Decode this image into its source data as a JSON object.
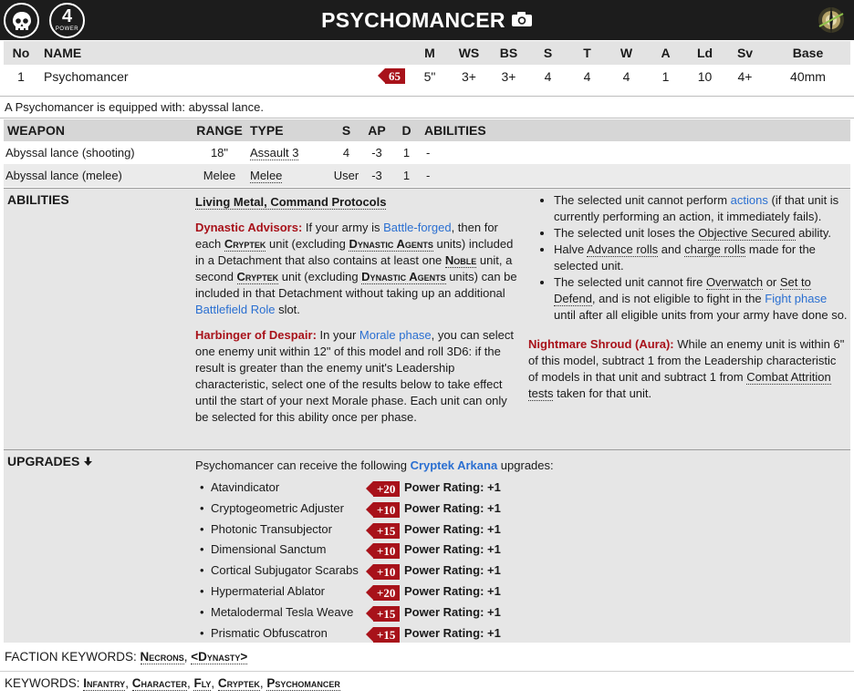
{
  "header": {
    "title": "PSYCHOMANCER",
    "power_value": "4",
    "power_label": "POWER",
    "skull_icon": "skull-icon",
    "camera_icon": "camera-icon",
    "faction_icon": "necron-glyph-icon"
  },
  "stats": {
    "headers": [
      "No",
      "NAME",
      "M",
      "WS",
      "BS",
      "S",
      "T",
      "W",
      "A",
      "Ld",
      "Sv",
      "Base"
    ],
    "row": {
      "no": "1",
      "name": "Psychomancer",
      "points": "65",
      "m": "5\"",
      "ws": "3+",
      "bs": "3+",
      "s": "4",
      "t": "4",
      "w": "4",
      "a": "1",
      "ld": "10",
      "sv": "4+",
      "base": "40mm"
    }
  },
  "equipment_text": "A Psychomancer is equipped with: abyssal lance.",
  "weapons": {
    "headers": [
      "WEAPON",
      "RANGE",
      "TYPE",
      "S",
      "AP",
      "D",
      "ABILITIES"
    ],
    "rows": [
      {
        "name": "Abyssal lance (shooting)",
        "range": "18\"",
        "type": "Assault 3",
        "s": "4",
        "ap": "-3",
        "d": "1",
        "abilities": "-"
      },
      {
        "name": "Abyssal lance (melee)",
        "range": "Melee",
        "type": "Melee",
        "s": "User",
        "ap": "-3",
        "d": "1",
        "abilities": "-"
      }
    ]
  },
  "abilities": {
    "label": "ABILITIES",
    "tags": "Living Metal, Command Protocols",
    "dynastic": {
      "name": "Dynastic Advisors:",
      "t1": " If your army is ",
      "l1": "Battle-forged",
      "t2": ", then for each ",
      "k1": "Cryptek",
      "t3": " unit (excluding ",
      "k2": "Dynastic Agents",
      "t4": " units) included in a Detachment that also contains at least one ",
      "k3": "Noble",
      "t5": " unit, a second ",
      "k4": "Cryptek",
      "t6": " unit (excluding ",
      "k5": "Dynastic Agents",
      "t7": " units) can be included in that Detachment without taking up an additional ",
      "l2": "Battlefield Role",
      "t8": " slot."
    },
    "harbinger": {
      "name": "Harbinger of Despair:",
      "t1": " In your ",
      "l1": "Morale phase",
      "t2": ", you can select one enemy unit within 12\" of this model and roll 3D6: if the result is greater than the enemy unit's Leadership characteristic, select one of the results below to take effect until the start of your next Morale phase. Each unit can only be selected for this ability once per phase."
    },
    "bullets": {
      "b1a": "The selected unit cannot perform ",
      "b1l": "actions",
      "b1b": " (if that unit is currently performing an action, it immediately fails).",
      "b2a": "The selected unit loses the ",
      "b2u": "Objective Secured",
      "b2b": " ability.",
      "b3a": "Halve ",
      "b3u1": "Advance rolls",
      "b3b": " and ",
      "b3u2": "charge rolls",
      "b3c": " made for the selected unit.",
      "b4a": "The selected unit cannot fire ",
      "b4u1": "Overwatch",
      "b4b": " or ",
      "b4u2": "Set to Defend",
      "b4c": ", and is not eligible to fight in the ",
      "b4l": "Fight phase",
      "b4d": " until after all eligible units from your army have done so."
    },
    "nightmare": {
      "name": "Nightmare Shroud (Aura):",
      "t1": " While an enemy unit is within 6\" of this model, subtract 1 from the Leadership characteristic of models in that unit and subtract 1 from ",
      "u1": "Combat Attrition tests",
      "t2": " taken for that unit."
    }
  },
  "upgrades": {
    "label": "UPGRADES",
    "intro_a": "Psychomancer can receive the following ",
    "intro_link": "Cryptek Arkana",
    "intro_b": " upgrades:",
    "items": [
      {
        "name": "Atavindicator",
        "points": "+20",
        "power": "Power Rating: +1"
      },
      {
        "name": "Cryptogeometric Adjuster",
        "points": "+10",
        "power": "Power Rating: +1"
      },
      {
        "name": "Photonic Transubjector",
        "points": "+15",
        "power": "Power Rating: +1"
      },
      {
        "name": "Dimensional Sanctum",
        "points": "+10",
        "power": "Power Rating: +1"
      },
      {
        "name": "Cortical Subjugator Scarabs",
        "points": "+10",
        "power": "Power Rating: +1"
      },
      {
        "name": "Hypermaterial Ablator",
        "points": "+20",
        "power": "Power Rating: +1"
      },
      {
        "name": "Metalodermal Tesla Weave",
        "points": "+15",
        "power": "Power Rating: +1"
      },
      {
        "name": "Prismatic Obfuscatron",
        "points": "+15",
        "power": "Power Rating: +1"
      }
    ]
  },
  "keywords": {
    "faction_label": "FACTION KEYWORDS: ",
    "faction": [
      "Necrons",
      "<Dynasty>"
    ],
    "label": "KEYWORDS: ",
    "list": [
      "Infantry",
      "Character",
      "Fly",
      "Cryptek",
      "Psychomancer"
    ]
  },
  "colors": {
    "header_bg": "#1c1c1c",
    "accent_red": "#a8121a",
    "link_blue": "#2a6fd1",
    "section_bg": "#e6e6e6"
  }
}
